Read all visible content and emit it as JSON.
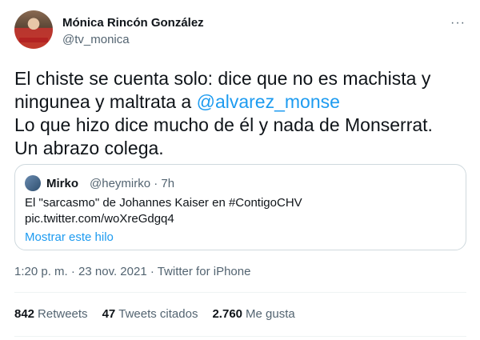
{
  "author": {
    "name": "Mónica Rincón González",
    "handle": "@tv_monica",
    "more": "···"
  },
  "tweet": {
    "line1": "El chiste se cuenta solo: dice que no es machista y",
    "line2_prefix": "ningunea y maltrata a ",
    "mention": "@alvarez_monse",
    "line3": "Lo que hizo dice mucho de él y nada de Monserrat.",
    "line4": "Un abrazo colega."
  },
  "quote": {
    "name": "Mirko",
    "meta": "@heymirko · 7h",
    "text_line1": "El \"sarcasmo\" de Johannes Kaiser en #ContigoCHV",
    "text_line2": "pic.twitter.com/woXreGdgq4",
    "show_thread": "Mostrar este hilo"
  },
  "timestamp": "1:20 p. m. · 23 nov. 2021 · Twitter for iPhone",
  "stats": {
    "retweets_count": "842",
    "retweets_label": "Retweets",
    "quotes_count": "47",
    "quotes_label": "Tweets citados",
    "likes_count": "2.760",
    "likes_label": "Me gusta"
  },
  "colors": {
    "accent": "#1d9bf0",
    "text": "#0f1419",
    "muted": "#536471"
  }
}
